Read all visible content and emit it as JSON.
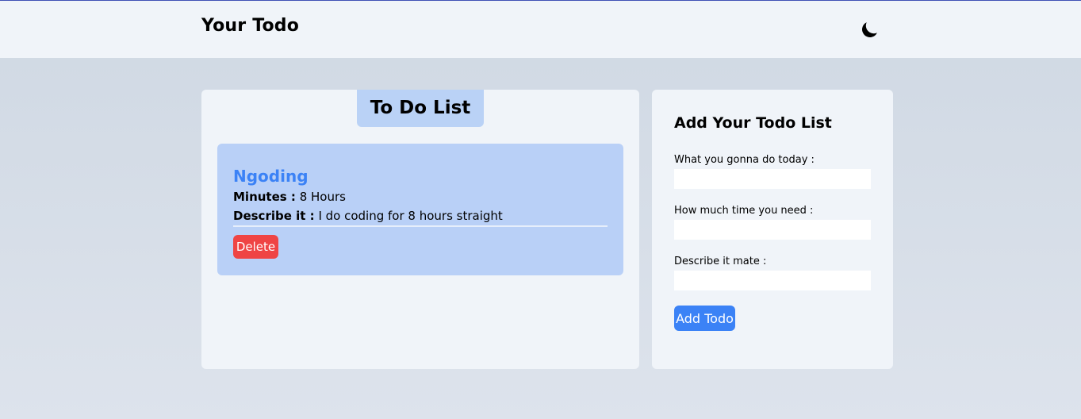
{
  "navbar": {
    "brand": "Your Todo",
    "theme_icon": "moon-icon"
  },
  "todo_list": {
    "heading": "To Do List",
    "items": [
      {
        "title": "Ngoding",
        "minutes_label": "Minutes :",
        "minutes_value": "8 Hours",
        "describe_label": "Describe it :",
        "describe_value": "I do coding for 8 hours straight",
        "delete_label": "Delete"
      }
    ]
  },
  "form": {
    "title": "Add Your Todo List",
    "fields": [
      {
        "label": "What you gonna do today :",
        "value": ""
      },
      {
        "label": "How much time you need :",
        "value": ""
      },
      {
        "label": "Describe it mate :",
        "value": ""
      }
    ],
    "submit_label": "Add Todo"
  },
  "colors": {
    "accent": "#3b82f6",
    "danger": "#ef4444",
    "card": "#f0f4f9",
    "item": "#b9d0f7"
  }
}
